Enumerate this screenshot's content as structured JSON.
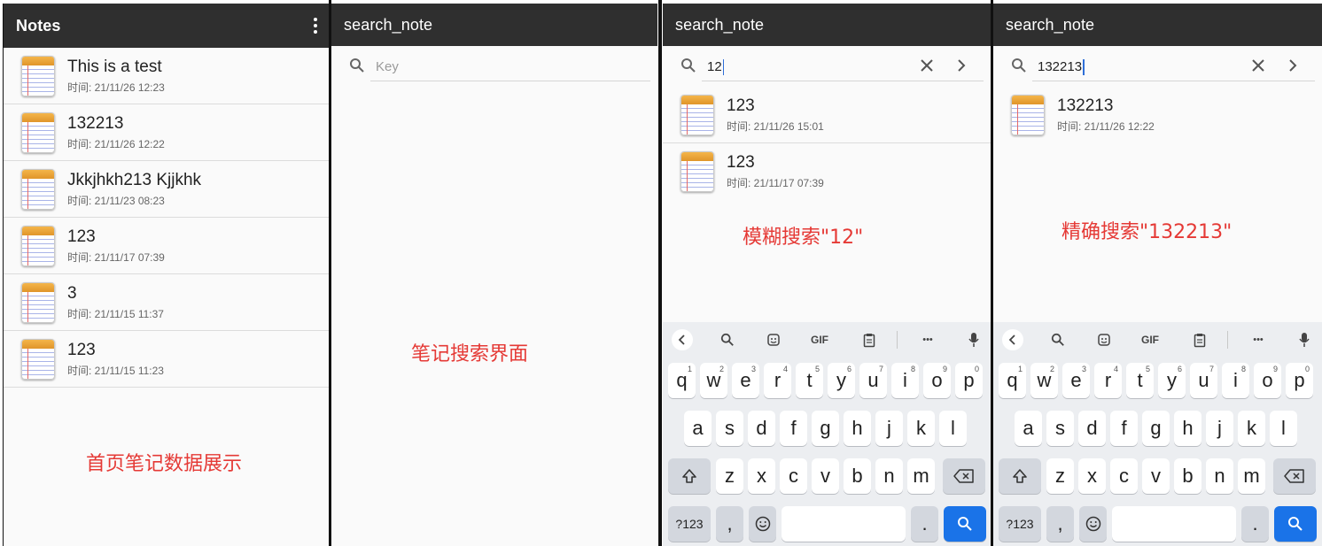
{
  "panel1": {
    "title": "Notes",
    "notes": [
      {
        "title": "This is a test",
        "time": "时间: 21/11/26 12:23"
      },
      {
        "title": "132213",
        "time": "时间: 21/11/26 12:22"
      },
      {
        "title": "Jkkjhkh213  Kjjkhk",
        "time": "时间: 21/11/23 08:23"
      },
      {
        "title": "123",
        "time": "时间: 21/11/17 07:39"
      },
      {
        "title": "3",
        "time": "时间: 21/11/15 11:37"
      },
      {
        "title": "123",
        "time": "时间: 21/11/15 11:23"
      }
    ],
    "caption": "首页笔记数据展示"
  },
  "panel2": {
    "title": "search_note",
    "search_placeholder": "Key",
    "caption": "笔记搜索界面"
  },
  "panel3": {
    "title": "search_note",
    "search_value": "12",
    "results": [
      {
        "title": "123",
        "time": "时间: 21/11/26 15:01"
      },
      {
        "title": "123",
        "time": "时间: 21/11/17 07:39"
      }
    ],
    "caption": "模糊搜索\"12\""
  },
  "panel4": {
    "title": "search_note",
    "search_value": "132213",
    "results": [
      {
        "title": "132213",
        "time": "时间: 21/11/26 12:22"
      }
    ],
    "caption": "精确搜索\"132213\""
  },
  "keyboard": {
    "toolbar": {
      "gif": "GIF",
      "more": "•••"
    },
    "row1": [
      "q",
      "w",
      "e",
      "r",
      "t",
      "y",
      "u",
      "i",
      "o",
      "p"
    ],
    "row1_digits": [
      "1",
      "2",
      "3",
      "4",
      "5",
      "6",
      "7",
      "8",
      "9",
      "0"
    ],
    "row2": [
      "a",
      "s",
      "d",
      "f",
      "g",
      "h",
      "j",
      "k",
      "l"
    ],
    "row3": [
      "z",
      "x",
      "c",
      "v",
      "b",
      "n",
      "m"
    ],
    "symbols": "?123",
    "comma": ",",
    "period": "."
  },
  "colors": {
    "appbar": "#2f2f2f",
    "caption": "#e53935",
    "search_key": "#1a73e8"
  }
}
